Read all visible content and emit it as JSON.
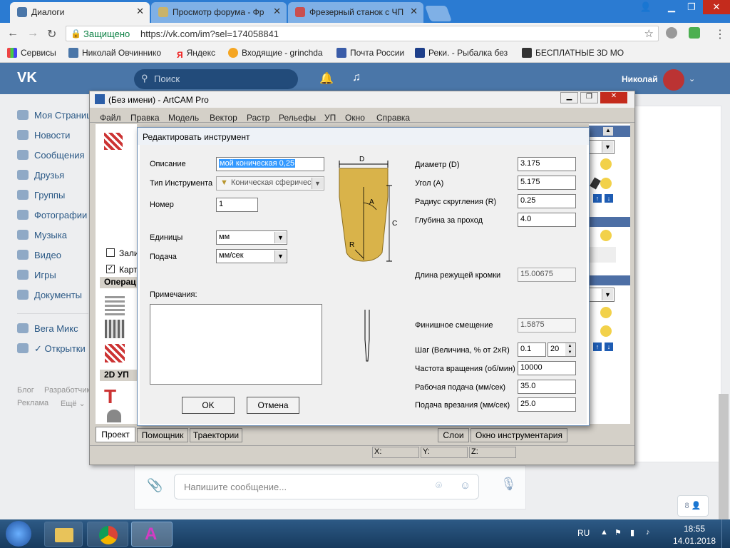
{
  "browser": {
    "tabs": [
      {
        "label": "Диалоги",
        "icon_color": "#4a76a8"
      },
      {
        "label": "Просмотр форума - Фр",
        "icon_color": "#c9b36b"
      },
      {
        "label": "Фрезерный станок с ЧП",
        "icon_color": "#c94f4f"
      }
    ],
    "secure_label": "Защищено",
    "url": "https://vk.com/im?sel=174058841",
    "bookmarks": [
      "Сервисы",
      "Николай Овчиннико",
      "Яндекс",
      "Входящие - grinchda",
      "Почта России",
      "Реки. - Рыбалка без",
      "БЕСПЛАТНЫЕ 3D МО"
    ]
  },
  "vk": {
    "search_placeholder": "Поиск",
    "user_name": "Николай",
    "menu": [
      "Моя Страница",
      "Новости",
      "Сообщения",
      "Друзья",
      "Группы",
      "Фотографии",
      "Музыка",
      "Видео",
      "Игры",
      "Документы",
      "Вега Микс",
      "✓ Открытки"
    ],
    "footer": [
      "Блог",
      "Разработчики",
      "Реклама",
      "Ещё ⌄"
    ],
    "message_placeholder": "Напишите сообщение...",
    "chat_count": "8"
  },
  "artcam": {
    "title": "(Без имени) - ArtCAM Pro",
    "menu": [
      "Файл",
      "Правка",
      "Модель",
      "Вектор",
      "Растр",
      "Рельефы",
      "УП",
      "Окно",
      "Справка"
    ],
    "left_labels": {
      "check1": "Зали",
      "check2": "Карт",
      "ops": "Операц",
      "twod": "2D УП"
    },
    "bottom_tabs": [
      "Проект",
      "Помощник",
      "Траектории"
    ],
    "right_tabs": [
      "Слои",
      "Окно инструментария"
    ],
    "status": [
      "X:",
      "Y:",
      "Z:"
    ]
  },
  "dialog": {
    "title": "Редактировать инструмент",
    "description_label": "Описание",
    "description_value": "мой коническая 0,25",
    "tool_type_label": "Тип Инструмента",
    "tool_type_value": "Коническая сферичес",
    "number_label": "Номер",
    "number_value": "1",
    "units_label": "Единицы",
    "units_value": "мм",
    "feed_label": "Подача",
    "feed_value": "мм/сек",
    "notes_label": "Примечания:",
    "ok_label": "OK",
    "cancel_label": "Отмена",
    "diagram": {
      "d": "D",
      "a": "A",
      "c": "C",
      "r": "R"
    },
    "params": [
      {
        "label": "Диаметр (D)",
        "value": "3.175"
      },
      {
        "label": "Угол (A)",
        "value": "5.175"
      },
      {
        "label": "Радиус скругления (R)",
        "value": "0.25"
      },
      {
        "label": "Глубина за проход",
        "value": "4.0"
      }
    ],
    "cut_length_label": "Длина режущей кромки",
    "cut_length_value": "15.00675",
    "finish_offset_label": "Финишное смещение",
    "finish_offset_value": "1.5875",
    "step_label": "Шаг (Величина, % от 2xR)",
    "step_value": "0.1",
    "step_percent": "20",
    "spindle_label": "Частота вращения (об/мин)",
    "spindle_value": "10000",
    "work_feed_label": "Рабочая подача (мм/сек)",
    "work_feed_value": "35.0",
    "plunge_label": "Подача врезания (мм/сек)",
    "plunge_value": "25.0"
  },
  "taskbar": {
    "lang": "RU",
    "time": "18:55",
    "date": "14.01.2018"
  },
  "colors": {
    "vk_blue": "#4a76a8",
    "tool_gold": "#d9b34a",
    "chrome_blue": "#2b7bd2"
  }
}
